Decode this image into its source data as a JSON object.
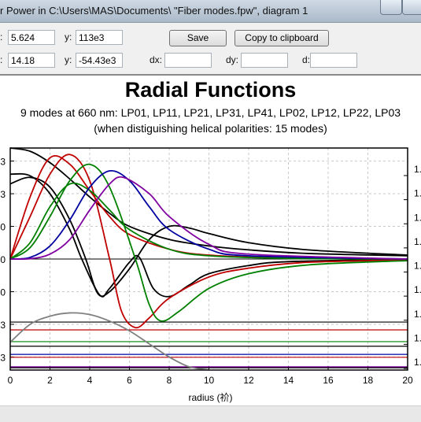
{
  "window": {
    "title": "r Power in C:\\Users\\MAS\\Documents\\ \"Fiber modes.fpw\", diagram 1"
  },
  "cursor": {
    "x1_label": ":",
    "x1": "5.624",
    "y1_label": "y:",
    "y1": "113e3",
    "x2_label": ":",
    "x2": "14.18",
    "y2_label": "y:",
    "y2": "-54.43e3",
    "dx_label": "dx:",
    "dx": "",
    "dy_label": "dy:",
    "dy": "",
    "d_label": "d:",
    "d": ""
  },
  "buttons": {
    "save": "Save",
    "copy": "Copy to clipboard"
  },
  "chart_data": {
    "type": "line",
    "title": "Radial Functions",
    "subtitle": "9 modes at 660 nm: LP01, LP11, LP21, LP31, LP41, LP02, LP12, LP22, LP03",
    "subtitle2": "(when distiguishing helical polarities: 15 modes)",
    "xlabel": "radius (祄)",
    "xlim": [
      0,
      20
    ],
    "xticks": [
      "0",
      "2",
      "4",
      "6",
      "8",
      "10",
      "12",
      "14",
      "16",
      "18",
      "20"
    ],
    "ylim": [
      -3.4,
      3.4
    ],
    "left_tick_labels": [
      "3",
      "3",
      "0",
      "0",
      "0",
      "3",
      "3"
    ],
    "right_tick_labels": [
      "1.",
      "1.",
      "1.",
      "1.",
      "1.",
      "1.",
      "1.",
      "1.",
      "1."
    ],
    "grid": true,
    "series": [
      {
        "color": "#000000",
        "points": [
          [
            0,
            3.4
          ],
          [
            1,
            3.3
          ],
          [
            2,
            2.95
          ],
          [
            3,
            2.45
          ],
          [
            4,
            1.9
          ],
          [
            5,
            1.4
          ],
          [
            6,
            1.0
          ],
          [
            8,
            0.6
          ],
          [
            10,
            0.4
          ],
          [
            12,
            0.28
          ],
          [
            15,
            0.17
          ],
          [
            20,
            0.1
          ]
        ]
      },
      {
        "color": "#000000",
        "points": [
          [
            0,
            2.3
          ],
          [
            1,
            2.5
          ],
          [
            2,
            2.2
          ],
          [
            3,
            1.2
          ],
          [
            3.8,
            0
          ],
          [
            4.4,
            -1.05
          ],
          [
            5,
            -1.0
          ],
          [
            6,
            -0.3
          ],
          [
            7,
            0.6
          ],
          [
            8,
            1.0
          ],
          [
            9,
            0.95
          ],
          [
            10,
            0.78
          ],
          [
            12,
            0.5
          ],
          [
            15,
            0.28
          ],
          [
            20,
            0.12
          ]
        ]
      },
      {
        "color": "#000000",
        "points": [
          [
            0,
            2.6
          ],
          [
            1,
            2.55
          ],
          [
            2,
            2.0
          ],
          [
            3,
            0.9
          ],
          [
            3.6,
            0
          ],
          [
            4.5,
            -1.1
          ],
          [
            5,
            -0.9
          ],
          [
            6,
            -0.1
          ],
          [
            6.5,
            0.05
          ],
          [
            7.2,
            -0.9
          ],
          [
            8,
            -1.15
          ],
          [
            9,
            -0.8
          ],
          [
            10,
            -0.45
          ],
          [
            12,
            -0.2
          ],
          [
            14,
            -0.08
          ],
          [
            20,
            0
          ]
        ]
      },
      {
        "color": "#c00000",
        "points": [
          [
            0,
            0
          ],
          [
            1,
            1.9
          ],
          [
            2,
            3.1
          ],
          [
            3,
            2.9
          ],
          [
            4,
            2.1
          ],
          [
            5,
            1.3
          ],
          [
            6,
            0.75
          ],
          [
            8,
            0.3
          ],
          [
            10,
            0.12
          ],
          [
            14,
            0.03
          ],
          [
            20,
            0
          ]
        ]
      },
      {
        "color": "#c00000",
        "points": [
          [
            0,
            0
          ],
          [
            1,
            1.3
          ],
          [
            2,
            2.6
          ],
          [
            3,
            3.2
          ],
          [
            4,
            2.4
          ],
          [
            5,
            0
          ],
          [
            5.6,
            -1.6
          ],
          [
            6.3,
            -2.1
          ],
          [
            7,
            -1.8
          ],
          [
            8,
            -1.2
          ],
          [
            10,
            -0.55
          ],
          [
            12,
            -0.28
          ],
          [
            15,
            -0.1
          ],
          [
            20,
            -0.03
          ]
        ]
      },
      {
        "color": "#008000",
        "points": [
          [
            0,
            0
          ],
          [
            1,
            0.5
          ],
          [
            2,
            1.6
          ],
          [
            3,
            2.3
          ],
          [
            4,
            2.1
          ],
          [
            5,
            1.5
          ],
          [
            6,
            0.9
          ],
          [
            8,
            0.3
          ],
          [
            10,
            0.1
          ],
          [
            14,
            0.02
          ],
          [
            20,
            0
          ]
        ]
      },
      {
        "color": "#008000",
        "points": [
          [
            0,
            0
          ],
          [
            1,
            0.35
          ],
          [
            2,
            1.3
          ],
          [
            3,
            2.4
          ],
          [
            4,
            2.9
          ],
          [
            5,
            2.2
          ],
          [
            6.3,
            0
          ],
          [
            7,
            -1.4
          ],
          [
            7.6,
            -1.9
          ],
          [
            8.5,
            -1.6
          ],
          [
            10,
            -0.9
          ],
          [
            12,
            -0.45
          ],
          [
            15,
            -0.18
          ],
          [
            20,
            -0.05
          ]
        ]
      },
      {
        "color": "#0000a0",
        "points": [
          [
            0,
            0
          ],
          [
            1,
            0.05
          ],
          [
            2,
            0.4
          ],
          [
            3,
            1.2
          ],
          [
            4,
            2.2
          ],
          [
            5,
            2.7
          ],
          [
            6,
            2.4
          ],
          [
            7,
            1.6
          ],
          [
            8,
            0.9
          ],
          [
            10,
            0.3
          ],
          [
            12,
            0.1
          ],
          [
            20,
            0
          ]
        ]
      },
      {
        "color": "#8000a0",
        "points": [
          [
            0,
            0
          ],
          [
            1,
            0.01
          ],
          [
            2,
            0.15
          ],
          [
            3,
            0.6
          ],
          [
            4,
            1.5
          ],
          [
            5,
            2.3
          ],
          [
            5.7,
            2.5
          ],
          [
            7,
            2.0
          ],
          [
            8,
            1.3
          ],
          [
            10,
            0.45
          ],
          [
            12,
            0.15
          ],
          [
            20,
            0
          ]
        ]
      },
      {
        "color": "#808080",
        "points": [
          [
            0,
            -2.55
          ],
          [
            1,
            -2.0
          ],
          [
            2,
            -1.75
          ],
          [
            3,
            -1.65
          ],
          [
            4,
            -1.7
          ],
          [
            5,
            -1.9
          ],
          [
            6,
            -2.2
          ],
          [
            7,
            -2.6
          ],
          [
            8,
            -3.0
          ],
          [
            9,
            -3.3
          ],
          [
            10,
            -3.4
          ]
        ]
      }
    ],
    "hlines": [
      {
        "color": "#000000",
        "y": -1.93
      },
      {
        "color": "#c00000",
        "y": -2.17
      },
      {
        "color": "#008000",
        "y": -2.53
      },
      {
        "color": "#000000",
        "y": -2.67
      },
      {
        "color": "#0000a0",
        "y": -2.92
      },
      {
        "color": "#c00000",
        "y": -3.01
      },
      {
        "color": "#8000a0",
        "y": -3.3
      },
      {
        "color": "#000000",
        "y": -3.33
      }
    ]
  }
}
